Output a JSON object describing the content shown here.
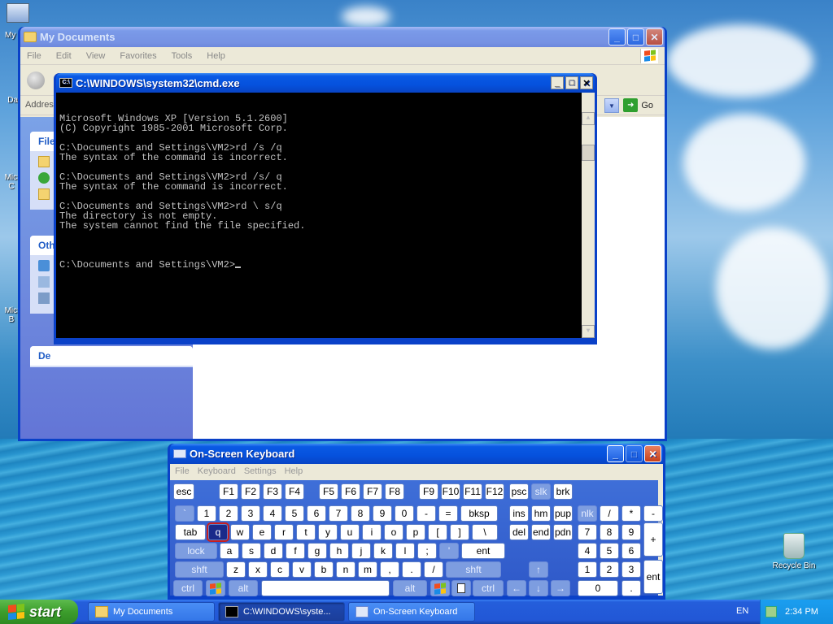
{
  "desktop": {
    "icons": [
      {
        "label": "My"
      },
      {
        "label": "Dat"
      },
      {
        "label": "Micro\nC"
      },
      {
        "label": "Micro\nB"
      },
      {
        "label": "Recycle Bin"
      }
    ]
  },
  "mydocs": {
    "title": "My Documents",
    "menu": [
      "File",
      "Edit",
      "View",
      "Favorites",
      "Tools",
      "Help"
    ],
    "address_label": "Addres",
    "go_label": "Go",
    "panels": [
      "File",
      "Oth",
      "De"
    ]
  },
  "cmd": {
    "title": "C:\\WINDOWS\\system32\\cmd.exe",
    "lines": [
      "Microsoft Windows XP [Version 5.1.2600]",
      "(C) Copyright 1985-2001 Microsoft Corp.",
      "",
      "C:\\Documents and Settings\\VM2>rd /s /q",
      "The syntax of the command is incorrect.",
      "",
      "C:\\Documents and Settings\\VM2>rd /s/ q",
      "The syntax of the command is incorrect.",
      "",
      "C:\\Documents and Settings\\VM2>rd \\ s/q",
      "The directory is not empty.",
      "The system cannot find the file specified.",
      ""
    ],
    "prompt": "C:\\Documents and Settings\\VM2>"
  },
  "osk": {
    "title": "On-Screen Keyboard",
    "menu": [
      "File",
      "Keyboard",
      "Settings",
      "Help"
    ],
    "keys": [
      {
        "label": "esc",
        "mod": false
      },
      {
        "label": "F1",
        "mod": false
      },
      {
        "label": "F2",
        "mod": false
      },
      {
        "label": "F3",
        "mod": false
      },
      {
        "label": "F4",
        "mod": false
      },
      {
        "label": "F5",
        "mod": false
      },
      {
        "label": "F6",
        "mod": false
      },
      {
        "label": "F7",
        "mod": false
      },
      {
        "label": "F8",
        "mod": false
      },
      {
        "label": "F9",
        "mod": false
      },
      {
        "label": "F10",
        "mod": false
      },
      {
        "label": "F11",
        "mod": false
      },
      {
        "label": "F12",
        "mod": false
      },
      {
        "label": "psc",
        "mod": false
      },
      {
        "label": "slk",
        "mod": true
      },
      {
        "label": "brk",
        "mod": false
      },
      {
        "label": "`",
        "mod": true
      },
      {
        "label": "1",
        "mod": false
      },
      {
        "label": "2",
        "mod": false
      },
      {
        "label": "3",
        "mod": false
      },
      {
        "label": "4",
        "mod": false
      },
      {
        "label": "5",
        "mod": false
      },
      {
        "label": "6",
        "mod": false
      },
      {
        "label": "7",
        "mod": false
      },
      {
        "label": "8",
        "mod": false
      },
      {
        "label": "9",
        "mod": false
      },
      {
        "label": "0",
        "mod": false
      },
      {
        "label": "-",
        "mod": false
      },
      {
        "label": "=",
        "mod": false
      },
      {
        "label": "bksp",
        "mod": false
      },
      {
        "label": "ins",
        "mod": false
      },
      {
        "label": "hm",
        "mod": false
      },
      {
        "label": "pup",
        "mod": false
      },
      {
        "label": "nlk",
        "mod": true
      },
      {
        "label": "/",
        "mod": false
      },
      {
        "label": "*",
        "mod": false
      },
      {
        "label": "-",
        "mod": false
      },
      {
        "label": "tab",
        "mod": false
      },
      {
        "label": "q",
        "mod": false,
        "selected": true
      },
      {
        "label": "w",
        "mod": false
      },
      {
        "label": "e",
        "mod": false
      },
      {
        "label": "r",
        "mod": false
      },
      {
        "label": "t",
        "mod": false
      },
      {
        "label": "y",
        "mod": false
      },
      {
        "label": "u",
        "mod": false
      },
      {
        "label": "i",
        "mod": false
      },
      {
        "label": "o",
        "mod": false
      },
      {
        "label": "p",
        "mod": false
      },
      {
        "label": "[",
        "mod": false
      },
      {
        "label": "]",
        "mod": false
      },
      {
        "label": "\\",
        "mod": false
      },
      {
        "label": "del",
        "mod": false
      },
      {
        "label": "end",
        "mod": false
      },
      {
        "label": "pdn",
        "mod": false
      },
      {
        "label": "7",
        "mod": false
      },
      {
        "label": "8",
        "mod": false
      },
      {
        "label": "9",
        "mod": false
      },
      {
        "label": "+",
        "mod": false
      },
      {
        "label": "lock",
        "mod": true
      },
      {
        "label": "a",
        "mod": false
      },
      {
        "label": "s",
        "mod": false
      },
      {
        "label": "d",
        "mod": false
      },
      {
        "label": "f",
        "mod": false
      },
      {
        "label": "g",
        "mod": false
      },
      {
        "label": "h",
        "mod": false
      },
      {
        "label": "j",
        "mod": false
      },
      {
        "label": "k",
        "mod": false
      },
      {
        "label": "l",
        "mod": false
      },
      {
        "label": ";",
        "mod": false
      },
      {
        "label": "'",
        "mod": true
      },
      {
        "label": "ent",
        "mod": false
      },
      {
        "label": "4",
        "mod": false
      },
      {
        "label": "5",
        "mod": false
      },
      {
        "label": "6",
        "mod": false
      },
      {
        "label": "shft",
        "mod": true
      },
      {
        "label": "z",
        "mod": false
      },
      {
        "label": "x",
        "mod": false
      },
      {
        "label": "c",
        "mod": false
      },
      {
        "label": "v",
        "mod": false
      },
      {
        "label": "b",
        "mod": false
      },
      {
        "label": "n",
        "mod": false
      },
      {
        "label": "m",
        "mod": false
      },
      {
        "label": ",",
        "mod": false
      },
      {
        "label": ".",
        "mod": false
      },
      {
        "label": "/",
        "mod": false
      },
      {
        "label": "shft",
        "mod": true
      },
      {
        "label": "↑",
        "mod": true
      },
      {
        "label": "1",
        "mod": false
      },
      {
        "label": "2",
        "mod": false
      },
      {
        "label": "3",
        "mod": false
      },
      {
        "label": "ent",
        "mod": false
      },
      {
        "label": "ctrl",
        "mod": true
      },
      {
        "label": "",
        "mod": true,
        "icon": "windows-logo-icon"
      },
      {
        "label": "alt",
        "mod": true
      },
      {
        "label": "",
        "mod": false,
        "space": true
      },
      {
        "label": "alt",
        "mod": true
      },
      {
        "label": "",
        "mod": true,
        "icon": "windows-logo-icon"
      },
      {
        "label": "",
        "mod": true,
        "icon": "menu-key-icon"
      },
      {
        "label": "ctrl",
        "mod": true
      },
      {
        "label": "←",
        "mod": true
      },
      {
        "label": "↓",
        "mod": true
      },
      {
        "label": "→",
        "mod": true
      },
      {
        "label": "0",
        "mod": false
      },
      {
        "label": ".",
        "mod": false
      }
    ]
  },
  "taskbar": {
    "start_label": "start",
    "tasks": [
      {
        "label": "My Documents",
        "active": false
      },
      {
        "label": "C:\\WINDOWS\\syste...",
        "active": true
      },
      {
        "label": "On-Screen Keyboard",
        "active": false
      }
    ],
    "lang": "EN",
    "clock": "2:34 PM"
  }
}
